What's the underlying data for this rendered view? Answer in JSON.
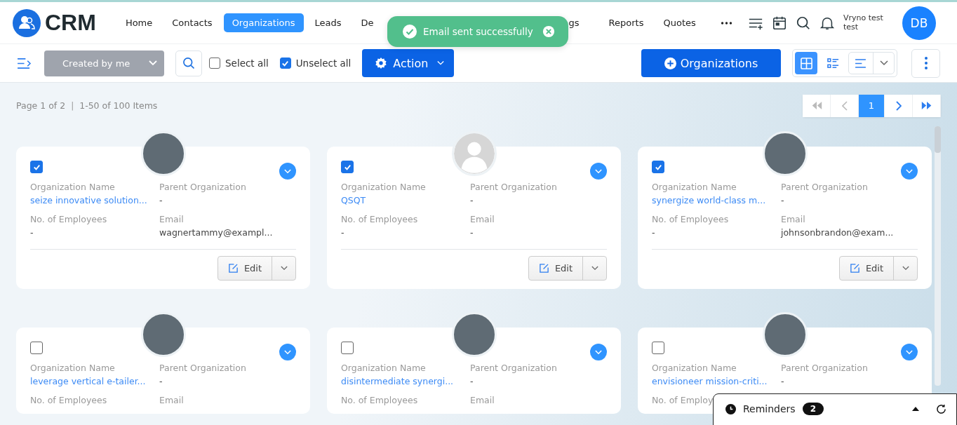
{
  "app": {
    "logo_text": "CRM"
  },
  "nav": [
    {
      "label": "Home",
      "selected": false,
      "kind": "full"
    },
    {
      "label": "Contacts",
      "selected": false,
      "kind": "full"
    },
    {
      "label": "Organizations",
      "selected": true,
      "kind": "full"
    },
    {
      "label": "Leads",
      "selected": false,
      "kind": "full"
    },
    {
      "label": "De",
      "selected": false,
      "kind": "clipped-end"
    },
    {
      "label": "gs",
      "selected": false,
      "kind": "clipped-start"
    },
    {
      "label": "Reports",
      "selected": false,
      "kind": "full"
    },
    {
      "label": "Quotes",
      "selected": false,
      "kind": "full"
    }
  ],
  "user": {
    "name": "Vryno test test",
    "initials": "DB"
  },
  "toast": {
    "message": "Email sent successfully"
  },
  "toolbar": {
    "filter": {
      "value": "Created by me"
    },
    "select_all": {
      "label": "Select all",
      "checked": false
    },
    "unselect_all": {
      "label": "Unselect all",
      "checked": true
    },
    "action": "Action",
    "add_button": "Organizations",
    "views": [
      {
        "kind": "grid",
        "selected": true
      },
      {
        "kind": "list",
        "selected": false
      }
    ]
  },
  "pagination": {
    "summary": "Page 1 of 2",
    "separator": "|",
    "range": "1-50 of 100 Items",
    "pages": [
      {
        "label": "1",
        "selected": true
      }
    ]
  },
  "cards": [
    {
      "checked": true,
      "logo": {
        "kind": "photo"
      },
      "fields": [
        {
          "label": "Organization Name",
          "value": "seize innovative solution...",
          "kind": "link"
        },
        {
          "label": "Parent Organization",
          "value": "-",
          "kind": "text"
        },
        {
          "label": "No. of Employees",
          "value": "-",
          "kind": "text"
        },
        {
          "label": "Email",
          "value": "wagnertammy@exampl...",
          "kind": "text"
        }
      ],
      "edit": "Edit"
    },
    {
      "checked": true,
      "logo": {
        "kind": "default-avatar"
      },
      "fields": [
        {
          "label": "Organization Name",
          "value": "QSQT",
          "kind": "link"
        },
        {
          "label": "Parent Organization",
          "value": "-",
          "kind": "text"
        },
        {
          "label": "No. of Employees",
          "value": "-",
          "kind": "text"
        },
        {
          "label": "Email",
          "value": "-",
          "kind": "text"
        }
      ],
      "edit": "Edit"
    },
    {
      "checked": true,
      "logo": {
        "kind": "photo"
      },
      "fields": [
        {
          "label": "Organization Name",
          "value": "synergize world-class m...",
          "kind": "link"
        },
        {
          "label": "Parent Organization",
          "value": "-",
          "kind": "text"
        },
        {
          "label": "No. of Employees",
          "value": "-",
          "kind": "text"
        },
        {
          "label": "Email",
          "value": "johnsonbrandon@exam...",
          "kind": "text"
        }
      ],
      "edit": "Edit"
    },
    {
      "checked": false,
      "logo": {
        "kind": "photo"
      },
      "fields": [
        {
          "label": "Organization Name",
          "value": "leverage vertical e-tailer...",
          "kind": "link"
        },
        {
          "label": "Parent Organization",
          "value": "-",
          "kind": "text"
        },
        {
          "label": "No. of Employees"
        },
        {
          "label": "Email"
        }
      ]
    },
    {
      "checked": false,
      "logo": {
        "kind": "photo"
      },
      "fields": [
        {
          "label": "Organization Name",
          "value": "disintermediate synergi...",
          "kind": "link"
        },
        {
          "label": "Parent Organization",
          "value": "-",
          "kind": "text"
        },
        {
          "label": "No. of Employees"
        },
        {
          "label": "Email"
        }
      ]
    },
    {
      "checked": false,
      "logo": {
        "kind": "photo"
      },
      "fields": [
        {
          "label": "Organization Name",
          "value": "envisioneer mission-criti...",
          "kind": "link"
        },
        {
          "label": "Parent Organization",
          "value": "-",
          "kind": "text"
        },
        {
          "label": "No. of Employ"
        }
      ]
    }
  ],
  "reminders": {
    "label": "Reminders",
    "count": "2"
  }
}
